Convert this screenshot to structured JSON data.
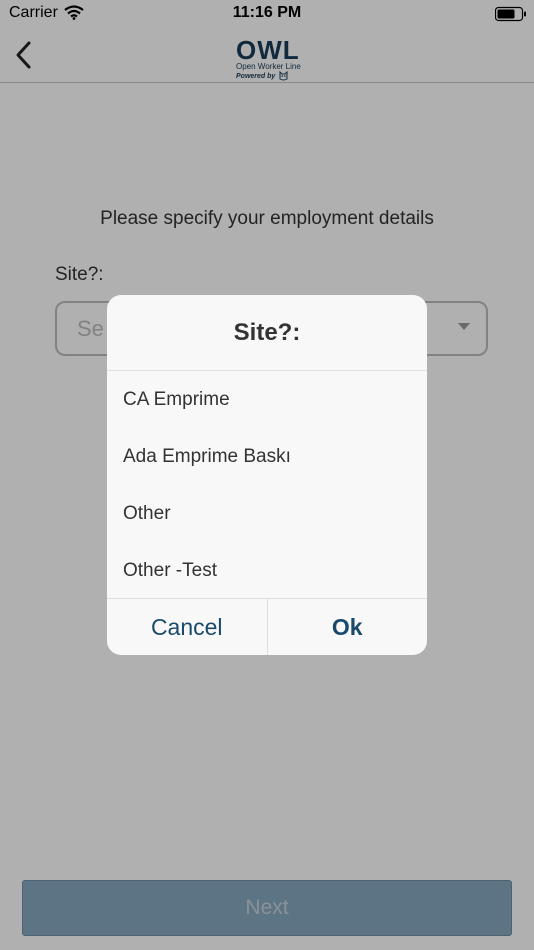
{
  "status_bar": {
    "carrier": "Carrier",
    "time": "11:16 PM",
    "icons": [
      "wifi-icon",
      "battery-icon"
    ]
  },
  "nav": {
    "back_icon": "chevron-left-icon",
    "logo": {
      "main": "OWL",
      "subtitle": "Open Worker Line",
      "powered_by": "Powered by"
    }
  },
  "form": {
    "prompt": "Please specify your employment details",
    "site_label": "Site?:",
    "site_select_placeholder": "Se"
  },
  "dialog": {
    "title": "Site?:",
    "options": [
      "CA Emprime",
      "Ada Emprime Baskı",
      "Other",
      "Other -Test"
    ],
    "cancel_label": "Cancel",
    "ok_label": "Ok"
  },
  "footer": {
    "next_label": "Next"
  },
  "colors": {
    "brand": "#1a3c57",
    "next_button_bg": "#87a8c0",
    "overlay": "rgba(0,0,0,0.31)",
    "action_text": "#1a4a6b"
  }
}
